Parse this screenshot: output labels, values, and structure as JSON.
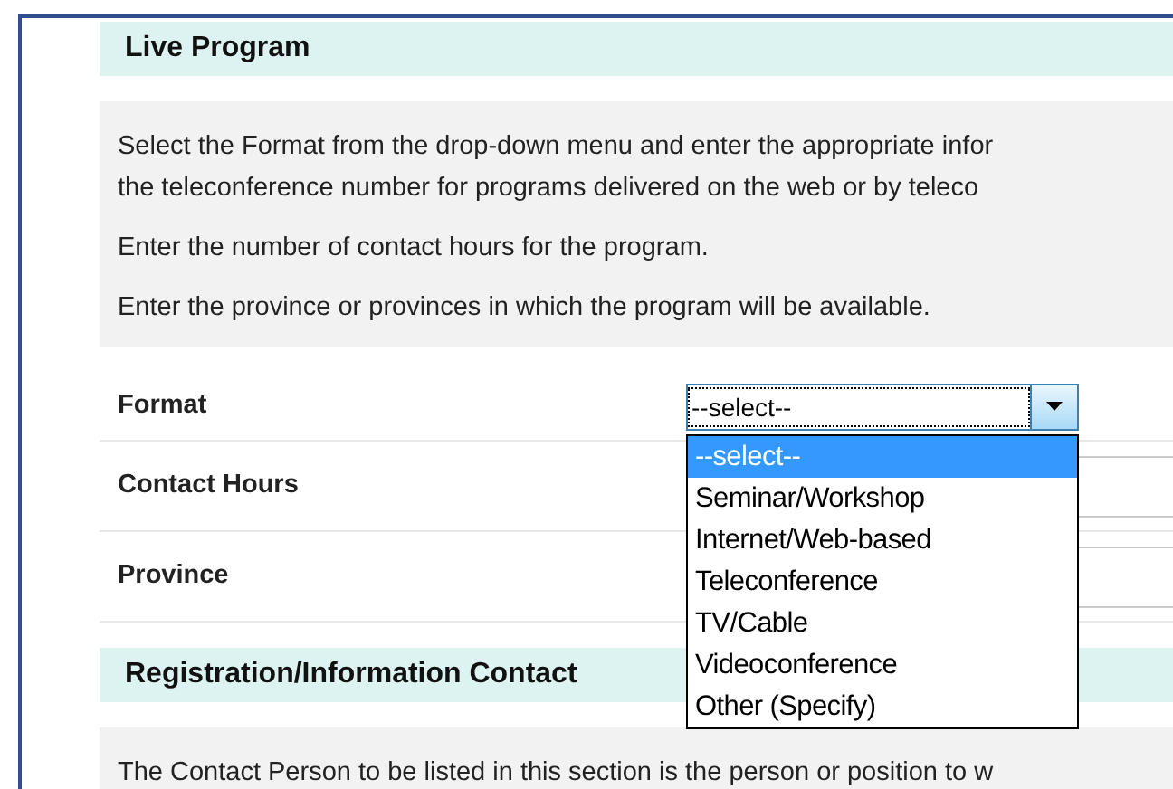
{
  "sections": [
    {
      "title": "Live Program",
      "instructions": [
        "Select the Format from the drop-down menu and enter the appropriate infor\nthe teleconference number for programs delivered on the web or by teleco",
        "Enter the number of contact hours for the program.",
        "Enter the province or provinces in which the program will be available."
      ],
      "fields": [
        {
          "label": "Format",
          "kind": "select",
          "value": "--select--",
          "expanded": true,
          "options": [
            {
              "label": "--select--",
              "selected": true
            },
            {
              "label": "Seminar/Workshop",
              "selected": false
            },
            {
              "label": "Internet/Web-based",
              "selected": false
            },
            {
              "label": "Teleconference",
              "selected": false
            },
            {
              "label": "TV/Cable",
              "selected": false
            },
            {
              "label": "Videoconference",
              "selected": false
            },
            {
              "label": "Other (Specify)",
              "selected": false
            }
          ]
        },
        {
          "label": "Contact Hours",
          "kind": "text"
        },
        {
          "label": "Province",
          "kind": "text"
        }
      ]
    },
    {
      "title": "Registration/Information Contact",
      "instructions": [
        "The Contact Person to be listed in this section is the person or position to w"
      ]
    }
  ]
}
